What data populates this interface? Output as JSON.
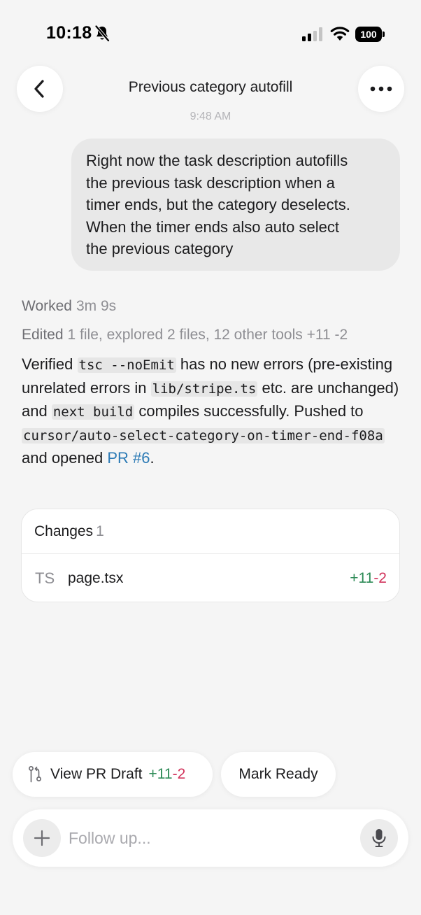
{
  "status_bar": {
    "time": "10:18",
    "battery": "100"
  },
  "header": {
    "title": "Previous category autofill",
    "timestamp": "9:48 AM"
  },
  "user_message": {
    "lines": [
      "Right now the task description autofills",
      "the previous task description when a",
      "timer ends, but the category deselects.",
      "When the timer ends also auto select",
      "the previous category"
    ]
  },
  "agent": {
    "worked_label": "Worked",
    "worked_value": "3m 9s",
    "edited_label": "Edited",
    "edited_value": "1 file, explored 2 files, 12 other tools +11 -2",
    "response": {
      "t1": "Verified ",
      "c1": "tsc --noEmit",
      "t2": " has no new errors (pre-existing unrelated errors in ",
      "c2": "lib/stripe.ts",
      "t3": " etc. are unchanged) and ",
      "c3": "next build",
      "t4": " compiles successfully. Pushed to ",
      "c4": "cursor/auto-select-category-on-timer-end-f08a",
      "t5": " and opened ",
      "link": "PR #6",
      "t6": "."
    }
  },
  "changes": {
    "title": "Changes",
    "count": "1",
    "files": [
      {
        "type": "TS",
        "name": "page.tsx",
        "added": "+11",
        "removed": "-2"
      }
    ]
  },
  "actions": {
    "view_pr_label": "View PR Draft",
    "view_pr_added": "+11",
    "view_pr_removed": "-2",
    "mark_ready_label": "Mark Ready"
  },
  "input": {
    "placeholder": "Follow up..."
  },
  "colors": {
    "background": "#f5f5f5",
    "added": "#2e8b57",
    "removed": "#d1335b",
    "link": "#2b7ab5"
  },
  "icons": [
    "bell-slash-icon",
    "signal-icon",
    "wifi-icon",
    "battery-icon",
    "chevron-left-icon",
    "ellipsis-icon",
    "branch-icon",
    "plus-icon",
    "microphone-icon"
  ]
}
